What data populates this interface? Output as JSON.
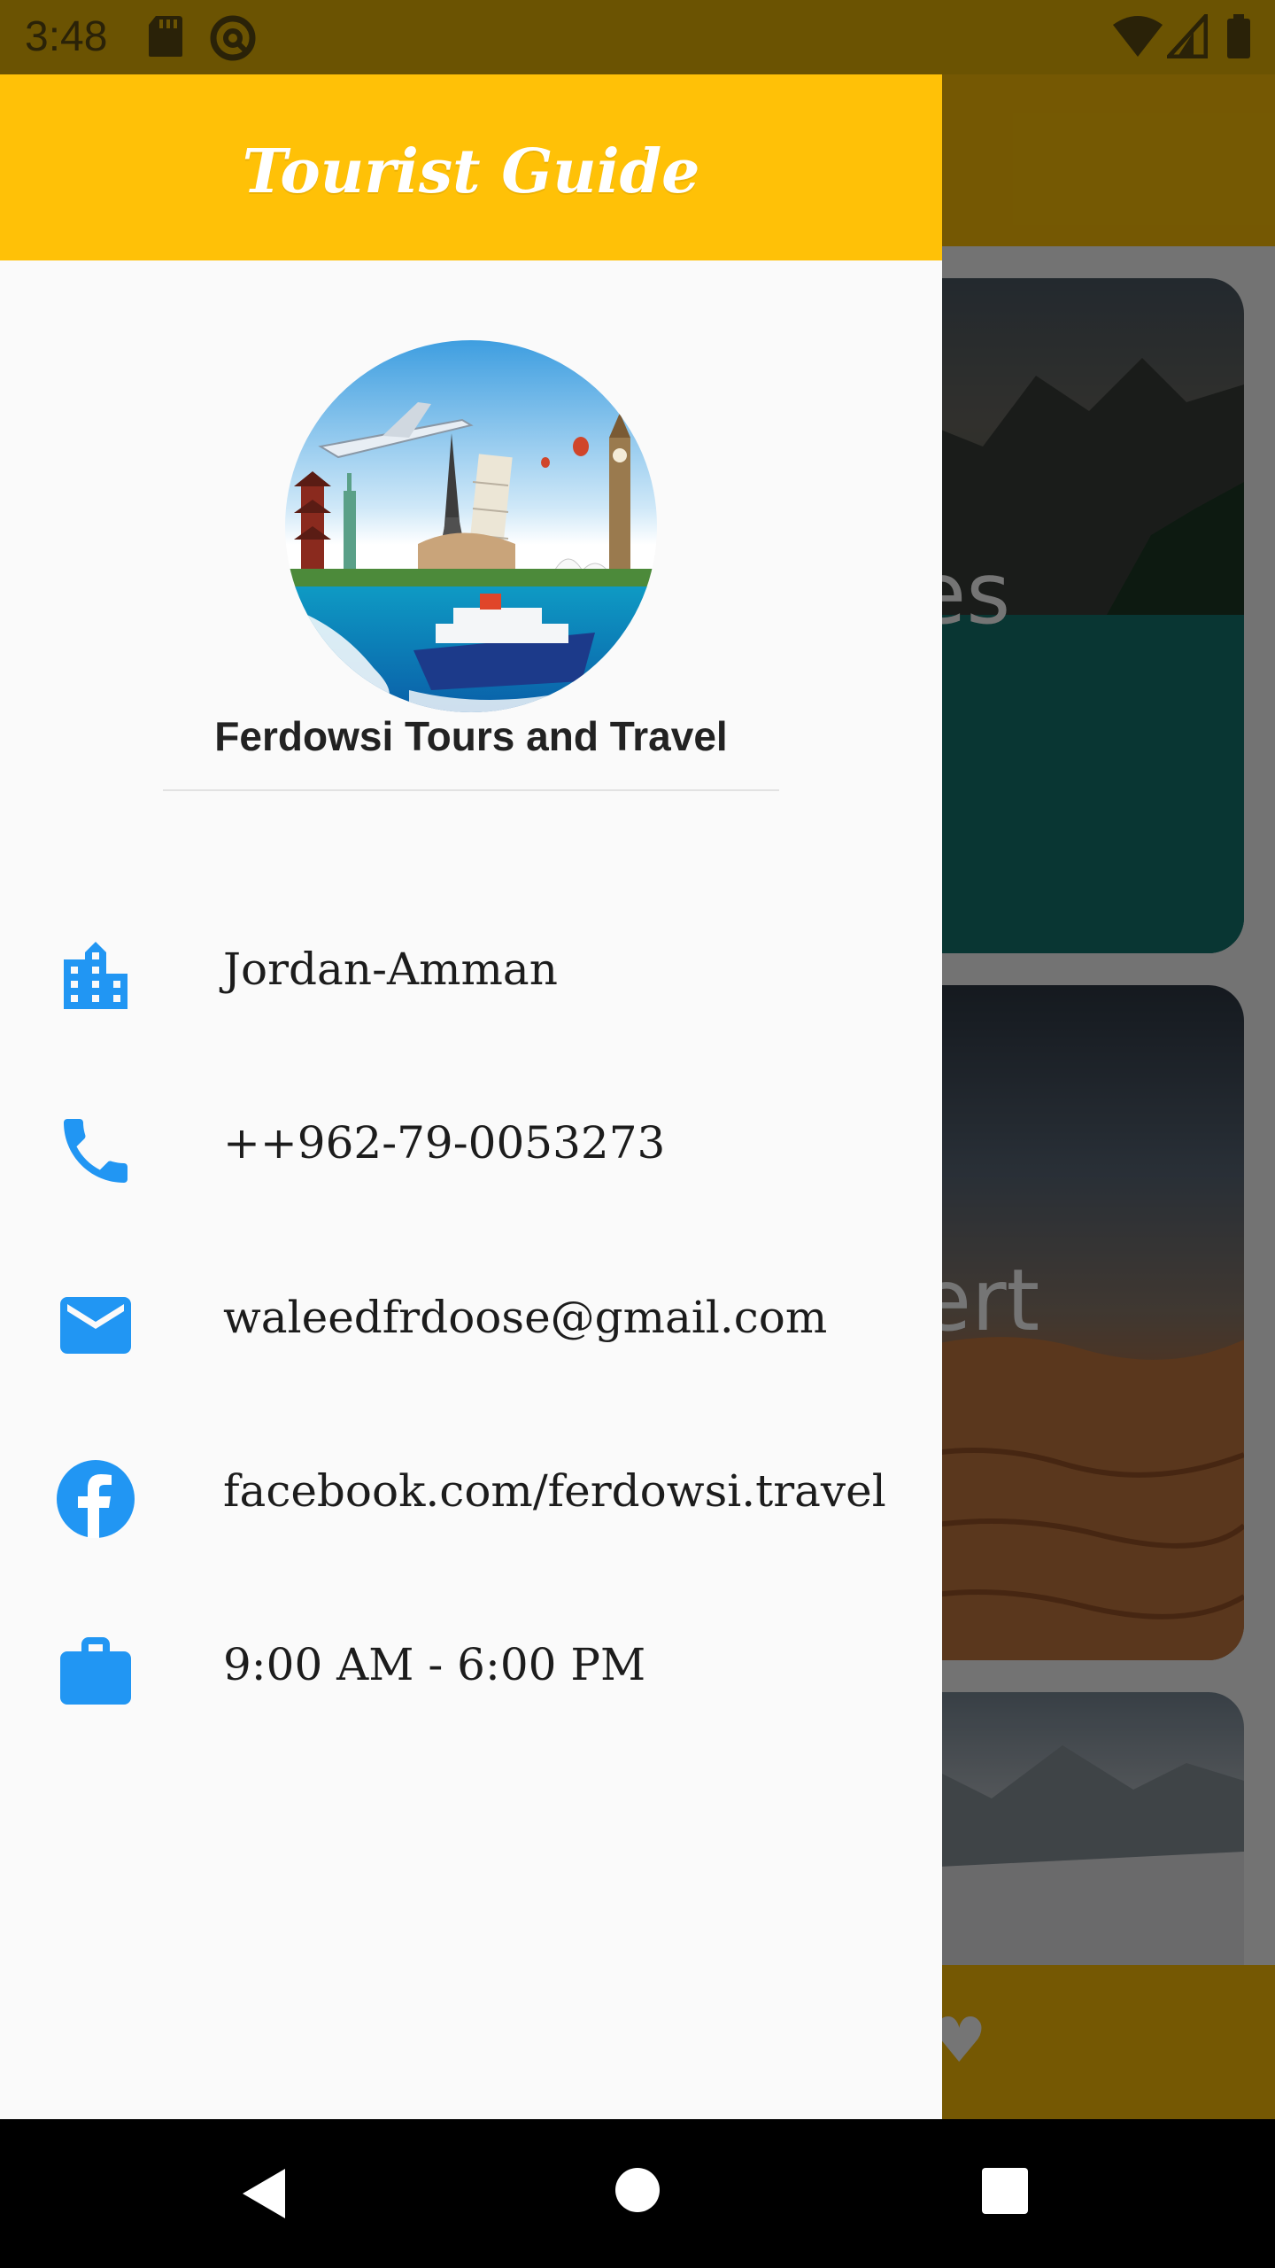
{
  "status_bar": {
    "time": "3:48",
    "icons": [
      "sd-card-icon",
      "do-not-disturb-icon",
      "wifi-icon",
      "cellular-signal-icon",
      "battery-icon"
    ]
  },
  "background_app": {
    "cards": [
      {
        "label": "kes"
      },
      {
        "label": "sert"
      },
      {
        "label": ""
      }
    ],
    "bottom_nav_icons": [
      "heart-icon"
    ],
    "accent_color": "#ffc107"
  },
  "drawer": {
    "title": "Tourist Guide",
    "header_color": "#ffc107",
    "company_name": "Ferdowsi Tours and Travel",
    "icon_color": "#2196f3",
    "items": [
      {
        "icon": "location-city-icon",
        "text": "Jordan-Amman"
      },
      {
        "icon": "phone-icon",
        "text": "++962-79-0053273"
      },
      {
        "icon": "email-icon",
        "text": "waleedfrdoose@gmail.com"
      },
      {
        "icon": "facebook-icon",
        "text": "facebook.com/ferdowsi.travel"
      },
      {
        "icon": "work-briefcase-icon",
        "text": "9:00 AM - 6:00 PM"
      }
    ]
  },
  "navigation_bar": {
    "buttons": [
      "back-button",
      "home-button",
      "recents-button"
    ]
  }
}
